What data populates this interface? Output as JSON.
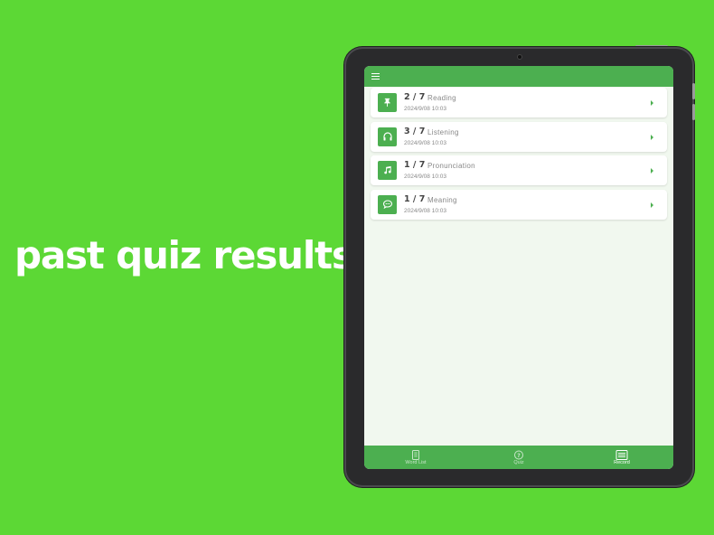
{
  "headline": "past quiz results",
  "colors": {
    "background": "#5cd835",
    "accent": "#4caf50",
    "screen_bg": "#f1f8ef"
  },
  "appbar": {
    "menu_icon": "hamburger-menu-icon"
  },
  "results": [
    {
      "score": "2 / 7",
      "type": "Reading",
      "date": "2024/9/08 10:03",
      "icon": "pin-icon"
    },
    {
      "score": "3 / 7",
      "type": "Listening",
      "date": "2024/9/08 10:03",
      "icon": "headphones-icon"
    },
    {
      "score": "1 / 7",
      "type": "Pronunciation",
      "date": "2024/9/08 10:03",
      "icon": "music-note-icon"
    },
    {
      "score": "1 / 7",
      "type": "Meaning",
      "date": "2024/9/08 10:03",
      "icon": "speech-bubble-icon"
    }
  ],
  "tabs": [
    {
      "label": "Word List",
      "icon": "book-icon",
      "active": false
    },
    {
      "label": "Quiz",
      "icon": "question-circle-icon",
      "active": false
    },
    {
      "label": "Record",
      "icon": "list-record-icon",
      "active": true
    }
  ]
}
